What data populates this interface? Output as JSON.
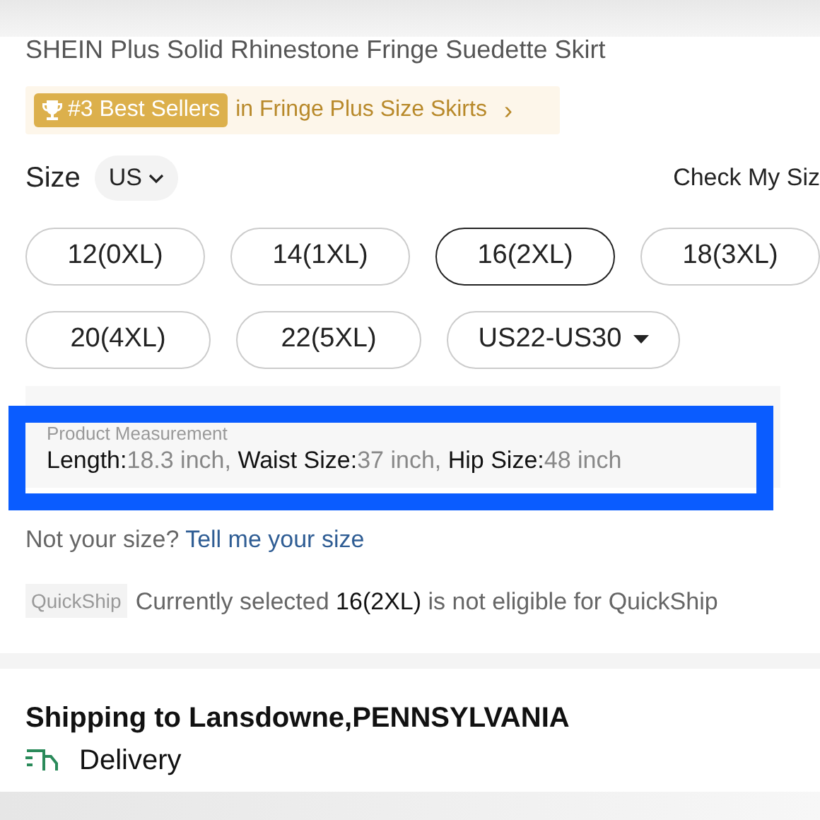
{
  "product_title": "SHEIN Plus Solid Rhinestone Fringe Suedette Skirt",
  "ranking": {
    "badge": "#3 Best Sellers",
    "category": "in Fringe Plus Size Skirts",
    "chevron": "›"
  },
  "size_header": {
    "label": "Size",
    "region": "US",
    "link": "Check My Siz"
  },
  "size_options": [
    {
      "kind": "size",
      "label": "12(0XL)",
      "selected": false
    },
    {
      "kind": "size",
      "label": "14(1XL)",
      "selected": false
    },
    {
      "kind": "size",
      "label": "16(2XL)",
      "selected": true
    },
    {
      "kind": "size",
      "label": "18(3XL)",
      "selected": false
    },
    {
      "kind": "size",
      "label": "20(4XL)",
      "selected": false
    },
    {
      "kind": "size",
      "label": "22(5XL)",
      "selected": false
    },
    {
      "kind": "dropdown",
      "label": "US22-US30",
      "selected": false
    }
  ],
  "measurement": {
    "title": "Product Measurement",
    "highlighted": true,
    "items": [
      {
        "label": "Length:",
        "value": "18.3 inch,"
      },
      {
        "label": "Waist Size:",
        "value": "37 inch,"
      },
      {
        "label": "Hip Size:",
        "value": "48 inch"
      }
    ]
  },
  "size_help": {
    "text": "Not your size?",
    "link": "Tell me your size"
  },
  "quickship": {
    "tag": "QuickShip",
    "before": "Currently selected",
    "size": "16(2XL)",
    "after": "is not eligible for QuickShip"
  },
  "shipping": {
    "title": "Shipping to Lansdowne,PENNSYLVANIA",
    "method": "Delivery"
  }
}
